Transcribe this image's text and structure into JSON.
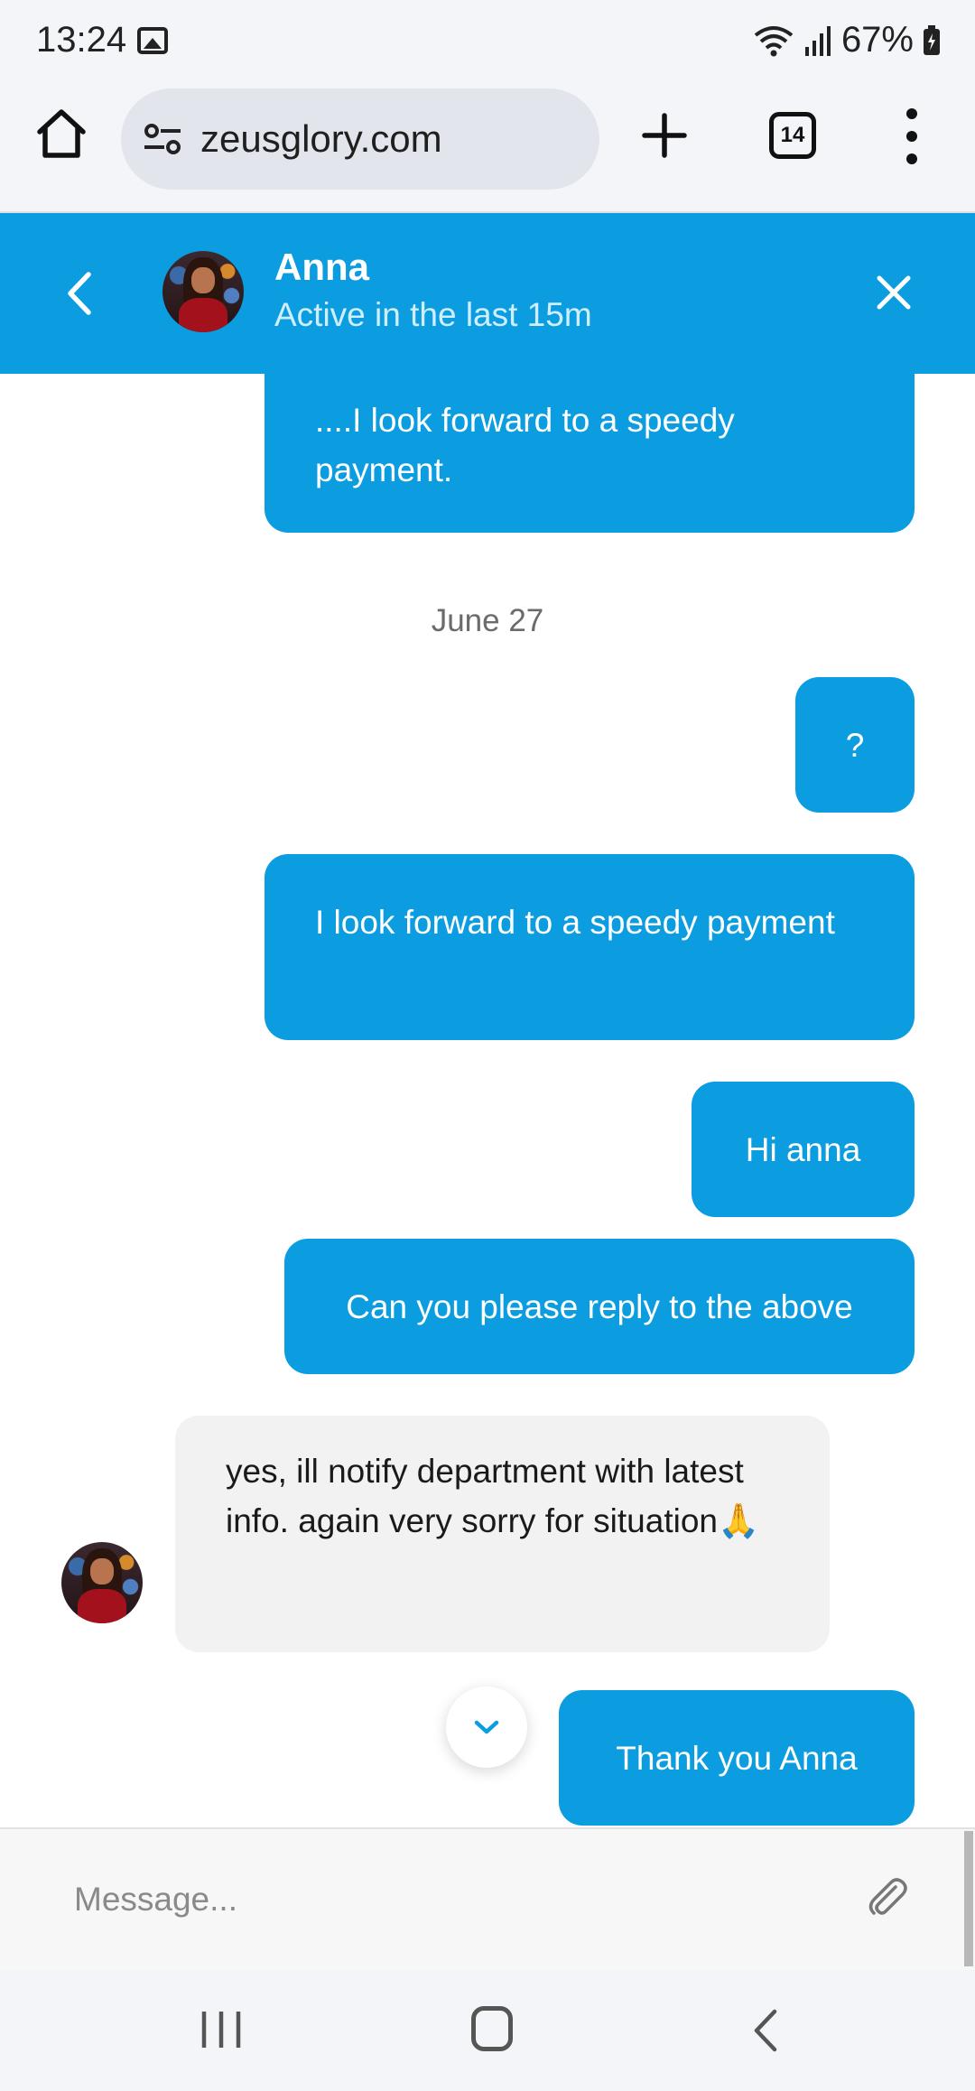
{
  "status_bar": {
    "time": "13:24",
    "battery": "67%"
  },
  "browser": {
    "url": "zeusglory.com",
    "tab_count": "14"
  },
  "chat_header": {
    "name": "Anna",
    "status": "Active in the last 15m"
  },
  "messages": {
    "out_1": "....I look forward to a speedy payment.",
    "date_separator": "June 27",
    "out_2": "?",
    "out_3": "I look forward to a speedy payment",
    "out_4": "Hi anna",
    "out_5": "Can you please reply to the above",
    "in_1": "yes, ill notify department with latest info. again very sorry for situation🙏",
    "out_6": "Thank you Anna"
  },
  "composer": {
    "placeholder": "Message..."
  },
  "colors": {
    "accent": "#0c9de0",
    "incoming_bubble": "#f2f2f2"
  },
  "icons": {
    "home": "home-icon",
    "site_settings": "tune-icon",
    "new_tab": "plus-icon",
    "tabs": "tab-switcher-icon",
    "menu": "more-vert-icon",
    "back": "chevron-left-icon",
    "close": "close-icon",
    "scroll_down": "chevron-down-icon",
    "attach": "paperclip-icon"
  }
}
